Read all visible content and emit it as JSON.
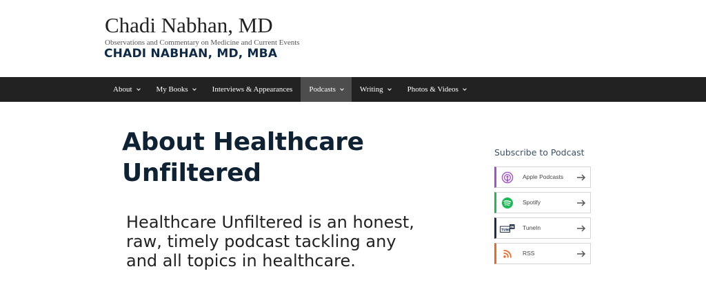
{
  "header": {
    "site_title": "Chadi Nabhan, MD",
    "tagline": "Observations and Commentary on Medicine and Current Events",
    "logo_text": "CHADI NABHAN, MD, MBA"
  },
  "nav": {
    "items": [
      {
        "label": "About",
        "has_dropdown": true,
        "active": false
      },
      {
        "label": "My Books",
        "has_dropdown": true,
        "active": false
      },
      {
        "label": "Interviews & Appearances",
        "has_dropdown": false,
        "active": false
      },
      {
        "label": "Podcasts",
        "has_dropdown": true,
        "active": true
      },
      {
        "label": "Writing",
        "has_dropdown": true,
        "active": false
      },
      {
        "label": "Photos & Videos",
        "has_dropdown": true,
        "active": false
      }
    ]
  },
  "main": {
    "title": "About Healthcare Unfiltered",
    "intro": "Healthcare Unfiltered is an honest, raw, timely podcast tackling any and all topics in healthcare."
  },
  "sidebar": {
    "heading": "Subscribe to Podcast",
    "buttons": [
      {
        "label": "Apple Podcasts",
        "icon": "apple-podcasts-icon",
        "color": "#a24fd4"
      },
      {
        "label": "Spotify",
        "icon": "spotify-icon",
        "color": "#1db954"
      },
      {
        "label": "TuneIn",
        "icon": "tunein-icon",
        "icon_text": "TUNE IN",
        "color": "#1c2e4a"
      },
      {
        "label": "RSS",
        "icon": "rss-icon",
        "color": "#f26522"
      }
    ]
  }
}
